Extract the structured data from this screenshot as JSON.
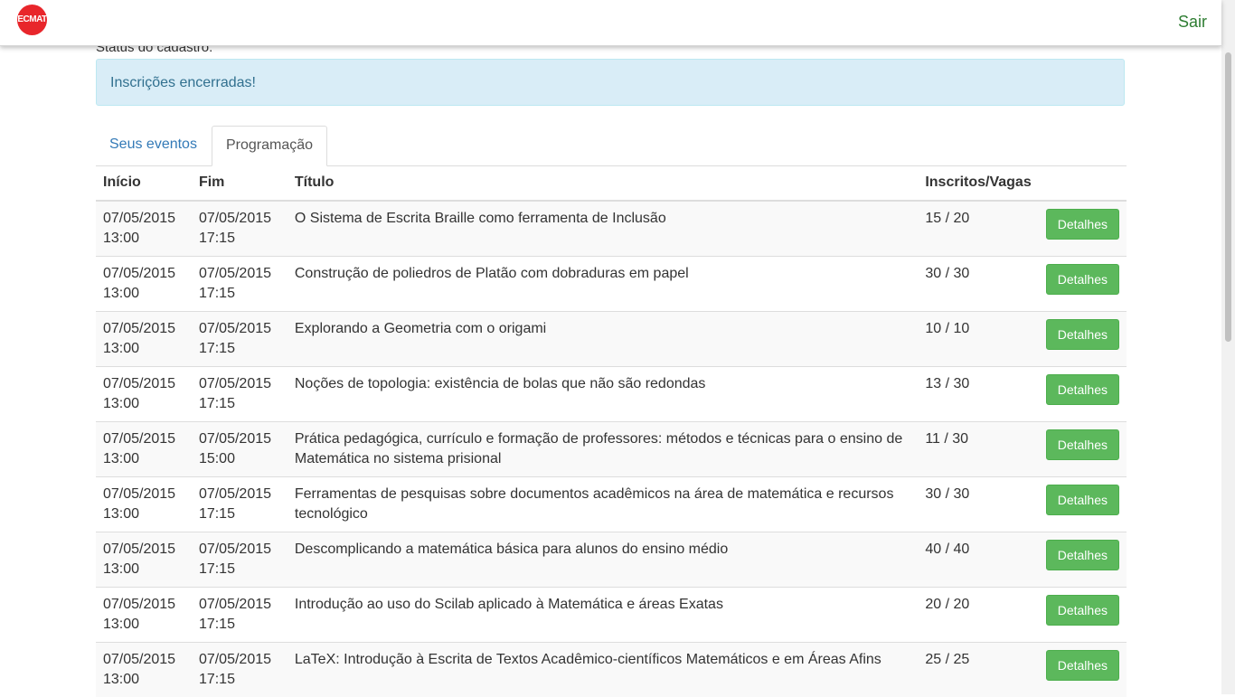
{
  "nav": {
    "logo_text": "ECMAT",
    "logout_label": "Sair"
  },
  "status_label": "Status do cadastro:",
  "alert_text": "Inscrições encerradas!",
  "tabs": [
    {
      "label": "Seus eventos",
      "active": false
    },
    {
      "label": "Programação",
      "active": true
    }
  ],
  "table": {
    "headers": [
      "Início",
      "Fim",
      "Título",
      "Inscritos/Vagas"
    ],
    "rows": [
      {
        "start_date": "07/05/2015",
        "start_time": "13:00",
        "end_date": "07/05/2015",
        "end_time": "17:15",
        "title": "O Sistema de Escrita Braille como ferramenta de Inclusão",
        "vagas": "15 / 20",
        "button": "Detalhes"
      },
      {
        "start_date": "07/05/2015",
        "start_time": "13:00",
        "end_date": "07/05/2015",
        "end_time": "17:15",
        "title": "Construção de poliedros de Platão com dobraduras em papel",
        "vagas": "30 / 30",
        "button": "Detalhes"
      },
      {
        "start_date": "07/05/2015",
        "start_time": "13:00",
        "end_date": "07/05/2015",
        "end_time": "17:15",
        "title": "Explorando a Geometria com o origami",
        "vagas": "10 / 10",
        "button": "Detalhes"
      },
      {
        "start_date": "07/05/2015",
        "start_time": "13:00",
        "end_date": "07/05/2015",
        "end_time": "17:15",
        "title": "Noções de topologia: existência de bolas que não são redondas",
        "vagas": "13 / 30",
        "button": "Detalhes"
      },
      {
        "start_date": "07/05/2015",
        "start_time": "13:00",
        "end_date": "07/05/2015",
        "end_time": "15:00",
        "title": "Prática pedagógica, currículo e formação de professores: métodos e técnicas para o ensino de Matemática no sistema prisional",
        "vagas": "11 / 30",
        "button": "Detalhes"
      },
      {
        "start_date": "07/05/2015",
        "start_time": "13:00",
        "end_date": "07/05/2015",
        "end_time": "17:15",
        "title": "Ferramentas de pesquisas sobre documentos acadêmicos na área de matemática e recursos tecnológico",
        "vagas": "30 / 30",
        "button": "Detalhes"
      },
      {
        "start_date": "07/05/2015",
        "start_time": "13:00",
        "end_date": "07/05/2015",
        "end_time": "17:15",
        "title": "Descomplicando a matemática básica para alunos do ensino médio",
        "vagas": "40 / 40",
        "button": "Detalhes"
      },
      {
        "start_date": "07/05/2015",
        "start_time": "13:00",
        "end_date": "07/05/2015",
        "end_time": "17:15",
        "title": "Introdução ao uso do Scilab aplicado à Matemática e áreas Exatas",
        "vagas": "20 / 20",
        "button": "Detalhes"
      },
      {
        "start_date": "07/05/2015",
        "start_time": "13:00",
        "end_date": "07/05/2015",
        "end_time": "17:15",
        "title": "LaTeX: Introdução à Escrita de Textos Acadêmico-científicos Matemáticos e em Áreas Afins",
        "vagas": "25 / 25",
        "button": "Detalhes"
      }
    ]
  },
  "colors": {
    "accent_link": "#337ab7",
    "alert_bg": "#d9edf7",
    "alert_text": "#31708f",
    "button_green": "#5cb85c",
    "logout_green": "#2e7d32",
    "logo_red": "#e8262b"
  }
}
